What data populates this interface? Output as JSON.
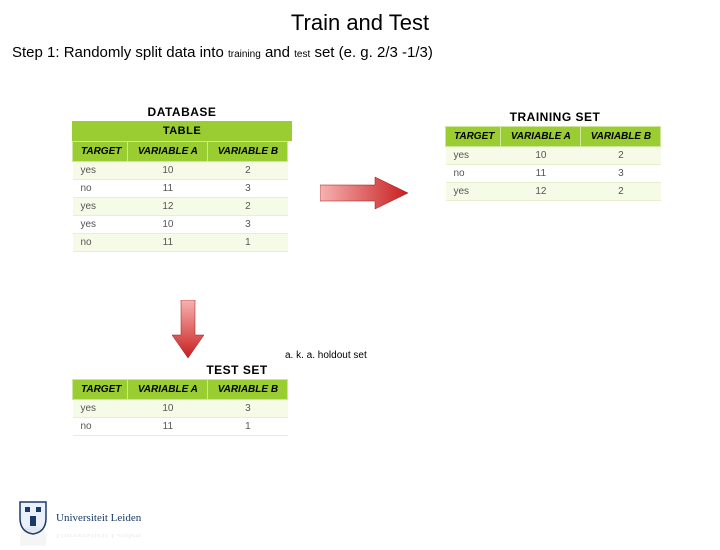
{
  "title": "Train and Test",
  "step_prefix": "Step 1: Randomly split data into ",
  "step_train": "training",
  "step_and": " and ",
  "step_test": "test",
  "step_suffix": " set (e. g. 2/3 -1/3)",
  "labels": {
    "database": "DATABASE",
    "training_set": "TRAINING SET",
    "test_set": "TEST SET",
    "table_caption": "TABLE"
  },
  "headers": [
    "TARGET",
    "VARIABLE A",
    "VARIABLE B"
  ],
  "database_rows": [
    [
      "yes",
      "10",
      "2"
    ],
    [
      "no",
      "11",
      "3"
    ],
    [
      "yes",
      "12",
      "2"
    ],
    [
      "yes",
      "10",
      "3"
    ],
    [
      "no",
      "11",
      "1"
    ]
  ],
  "training_rows": [
    [
      "yes",
      "10",
      "2"
    ],
    [
      "no",
      "11",
      "3"
    ],
    [
      "yes",
      "12",
      "2"
    ]
  ],
  "test_rows": [
    [
      "yes",
      "10",
      "3"
    ],
    [
      "no",
      "11",
      "1"
    ]
  ],
  "aka": "a. k. a. holdout set",
  "uni": "Universiteit Leiden"
}
